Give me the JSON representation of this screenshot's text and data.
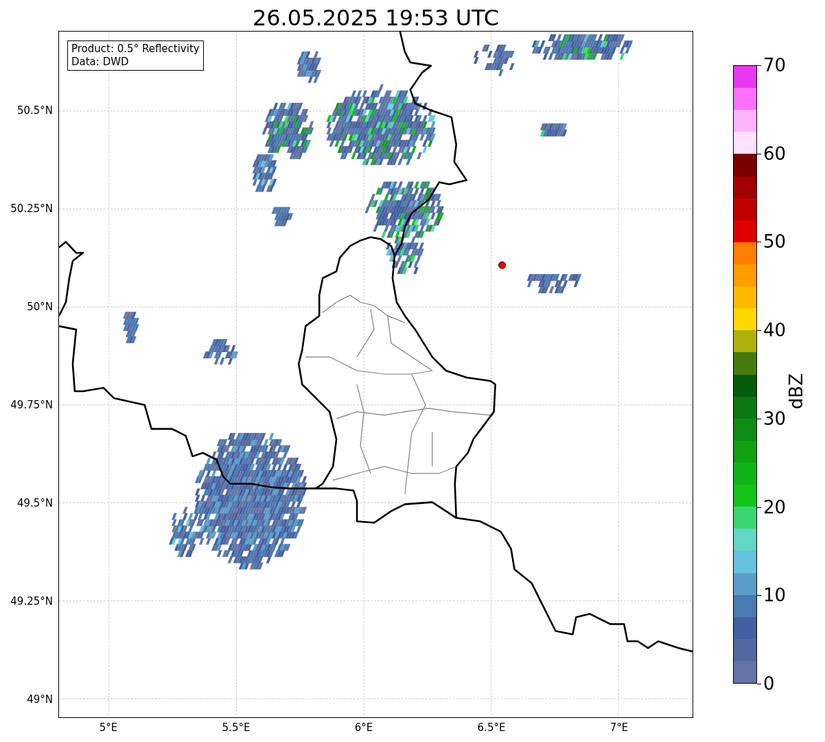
{
  "title": "26.05.2025 19:53 UTC",
  "legend": [
    "Product: 0.5° Reflectivity",
    "Data: DWD"
  ],
  "y_ticks": [
    "50.5°N",
    "50.25°N",
    "50°N",
    "49.75°N",
    "49.5°N",
    "49.25°N",
    "49°N"
  ],
  "x_ticks": [
    "5°E",
    "5.5°E",
    "6°E",
    "6.5°E",
    "7°E"
  ],
  "colorbar": {
    "label": "dBZ",
    "ticks": [
      "70",
      "60",
      "50",
      "40",
      "30",
      "20",
      "10",
      "0"
    ],
    "segments": [
      {
        "color": "#6474a6"
      },
      {
        "color": "#5468a0"
      },
      {
        "color": "#4460a0"
      },
      {
        "color": "#4a7ab2"
      },
      {
        "color": "#5a9ec8"
      },
      {
        "color": "#66c2de"
      },
      {
        "color": "#62d6c4"
      },
      {
        "color": "#3cd670"
      },
      {
        "color": "#12c41a"
      },
      {
        "color": "#10b418"
      },
      {
        "color": "#10a012"
      },
      {
        "color": "#0e8c14"
      },
      {
        "color": "#0a7814"
      },
      {
        "color": "#085a0c"
      },
      {
        "color": "#467a0e"
      },
      {
        "color": "#b0b00a"
      },
      {
        "color": "#ffd800"
      },
      {
        "color": "#ffb800"
      },
      {
        "color": "#ff9c00"
      },
      {
        "color": "#ff7e00"
      },
      {
        "color": "#e00000"
      },
      {
        "color": "#c00000"
      },
      {
        "color": "#a00000"
      },
      {
        "color": "#7a0000"
      },
      {
        "color": "#ffe0ff"
      },
      {
        "color": "#ffb4ff"
      },
      {
        "color": "#ff70ff"
      },
      {
        "color": "#e838f0"
      }
    ]
  }
}
